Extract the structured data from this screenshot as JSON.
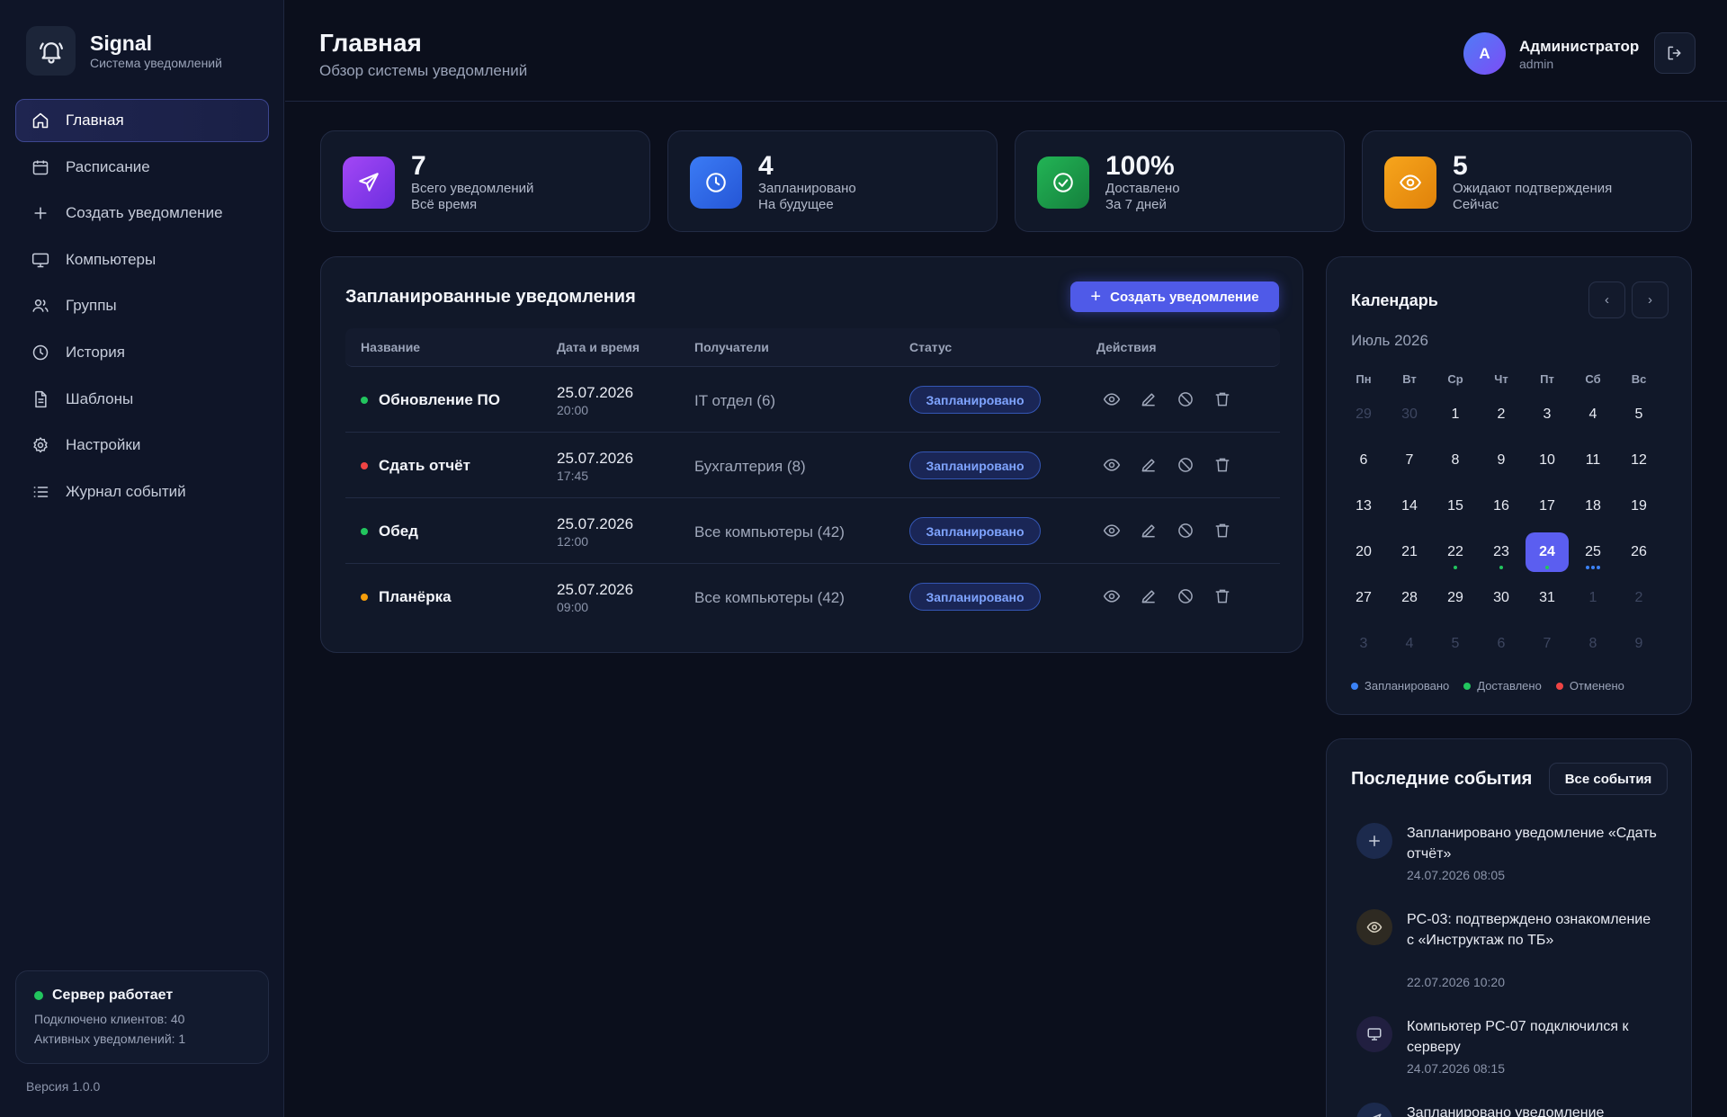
{
  "brand": {
    "name": "Signal",
    "subtitle": "Система уведомлений"
  },
  "nav": [
    {
      "label": "Главная",
      "icon": "home-icon",
      "active": true
    },
    {
      "label": "Расписание",
      "icon": "calendar-icon"
    },
    {
      "label": "Создать уведомление",
      "icon": "plus-icon"
    },
    {
      "label": "Компьютеры",
      "icon": "monitor-icon"
    },
    {
      "label": "Группы",
      "icon": "users-icon"
    },
    {
      "label": "История",
      "icon": "clock-icon"
    },
    {
      "label": "Шаблоны",
      "icon": "file-icon"
    },
    {
      "label": "Настройки",
      "icon": "gear-icon"
    },
    {
      "label": "Журнал событий",
      "icon": "list-icon"
    }
  ],
  "server": {
    "title": "Сервер работает",
    "clients": "Подключено клиентов: 40",
    "active": "Активных уведомлений: 1"
  },
  "version": "Версия 1.0.0",
  "header": {
    "title": "Главная",
    "subtitle": "Обзор системы уведомлений",
    "user_initial": "A",
    "user_name": "Администратор",
    "user_login": "admin"
  },
  "stats": [
    {
      "value": "7",
      "label": "Всего уведомлений",
      "sub": "Всё время",
      "color": "#8b3ff0"
    },
    {
      "value": "4",
      "label": "Запланировано",
      "sub": "На будущее",
      "color": "#2f6cf0"
    },
    {
      "value": "100%",
      "label": "Доставлено",
      "sub": "За 7 дней",
      "color": "#16a34a"
    },
    {
      "value": "5",
      "label": "Ожидают подтверждения",
      "sub": "Сейчас",
      "color": "#f59e0b"
    }
  ],
  "scheduled": {
    "title": "Запланированные уведомления",
    "create_label": "Создать уведомление",
    "columns": [
      "Название",
      "Дата и время",
      "Получатели",
      "Статус",
      "Действия"
    ],
    "rows": [
      {
        "name": "Обновление ПО",
        "date": "25.07.2026",
        "time": "20:00",
        "recipients": "IT отдел (6)",
        "status": "Запланировано",
        "dot": "#22c55e"
      },
      {
        "name": "Сдать отчёт",
        "date": "25.07.2026",
        "time": "17:45",
        "recipients": "Бухгалтерия (8)",
        "status": "Запланировано",
        "dot": "#ef4444"
      },
      {
        "name": "Обед",
        "date": "25.07.2026",
        "time": "12:00",
        "recipients": "Все компьютеры (42)",
        "status": "Запланировано",
        "dot": "#22c55e"
      },
      {
        "name": "Планёрка",
        "date": "25.07.2026",
        "time": "09:00",
        "recipients": "Все компьютеры (42)",
        "status": "Запланировано",
        "dot": "#f59e0b"
      }
    ]
  },
  "calendar": {
    "title": "Календарь",
    "prev": "‹",
    "next": "›",
    "month": "Июль 2026",
    "weekdays": [
      "Пн",
      "Вт",
      "Ср",
      "Чт",
      "Пт",
      "Сб",
      "Вс"
    ],
    "days": [
      {
        "d": "29",
        "m": true
      },
      {
        "d": "30",
        "m": true
      },
      {
        "d": "1"
      },
      {
        "d": "2"
      },
      {
        "d": "3"
      },
      {
        "d": "4"
      },
      {
        "d": "5"
      },
      {
        "d": "6"
      },
      {
        "d": "7"
      },
      {
        "d": "8"
      },
      {
        "d": "9"
      },
      {
        "d": "10"
      },
      {
        "d": "11"
      },
      {
        "d": "12"
      },
      {
        "d": "13"
      },
      {
        "d": "14"
      },
      {
        "d": "15"
      },
      {
        "d": "16"
      },
      {
        "d": "17"
      },
      {
        "d": "18"
      },
      {
        "d": "19"
      },
      {
        "d": "20"
      },
      {
        "d": "21"
      },
      {
        "d": "22",
        "marks": [
          "#22c55e"
        ]
      },
      {
        "d": "23",
        "marks": [
          "#22c55e"
        ]
      },
      {
        "d": "24",
        "today": true,
        "marks": [
          "#22c55e"
        ]
      },
      {
        "d": "25",
        "marks": [
          "#3b82f6",
          "#3b82f6",
          "#3b82f6"
        ]
      },
      {
        "d": "26"
      },
      {
        "d": "27"
      },
      {
        "d": "28"
      },
      {
        "d": "29"
      },
      {
        "d": "30"
      },
      {
        "d": "31"
      },
      {
        "d": "1",
        "m": true
      },
      {
        "d": "2",
        "m": true
      },
      {
        "d": "3",
        "m": true
      },
      {
        "d": "4",
        "m": true
      },
      {
        "d": "5",
        "m": true
      },
      {
        "d": "6",
        "m": true
      },
      {
        "d": "7",
        "m": true
      },
      {
        "d": "8",
        "m": true
      },
      {
        "d": "9",
        "m": true
      }
    ],
    "legend": [
      {
        "label": "Запланировано",
        "color": "#3b82f6"
      },
      {
        "label": "Доставлено",
        "color": "#22c55e"
      },
      {
        "label": "Отменено",
        "color": "#ef4444"
      }
    ]
  },
  "events": {
    "title": "Последние события",
    "all_label": "Все события",
    "items": [
      {
        "text": "Запланировано уведомление «Сдать отчёт»",
        "time": "24.07.2026 08:05",
        "icon": "plus-icon"
      },
      {
        "text": "PC-03: подтверждено ознакомление с «Инструктаж по ТБ»",
        "time": "22.07.2026 10:20",
        "icon": "eye-icon"
      },
      {
        "text": "Компьютер PC-07 подключился к серверу",
        "time": "24.07.2026 08:15",
        "icon": "monitor-icon"
      },
      {
        "text": "Запланировано уведомление",
        "time": "",
        "icon": "send-icon"
      }
    ]
  }
}
